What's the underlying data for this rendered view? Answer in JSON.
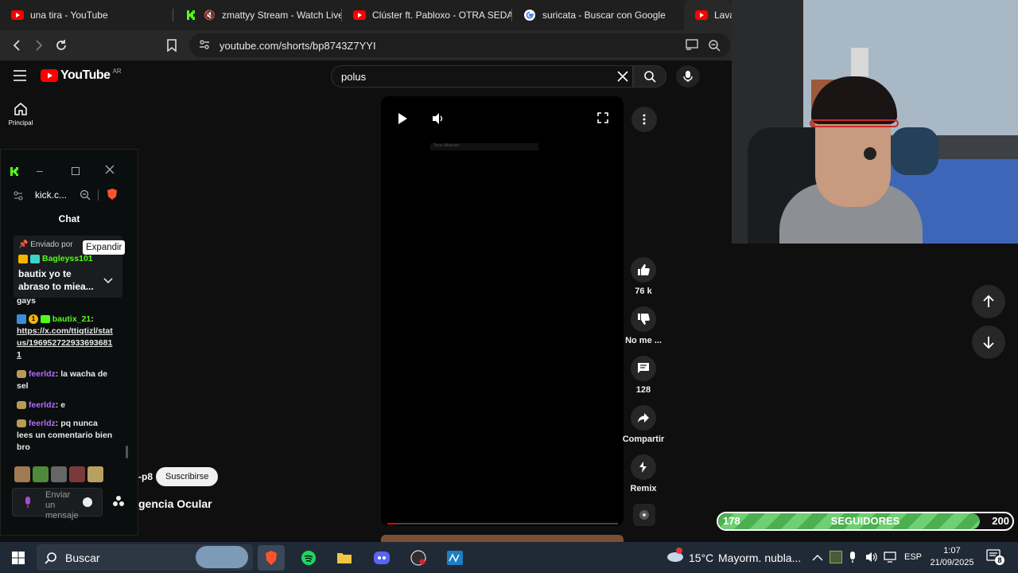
{
  "tabs": [
    {
      "title": "una tira - YouTube",
      "icon": "youtube-icon"
    },
    {
      "title": "zmattyy Stream - Watch Live o",
      "icon": "kick-icon"
    },
    {
      "title": "Clúster ft. Pabloxo - OTRA SEDA (\\",
      "icon": "youtube-icon"
    },
    {
      "title": "suricata - Buscar con Google",
      "icon": "google-icon"
    },
    {
      "title": "Lava",
      "icon": "youtube-icon"
    }
  ],
  "toolbar": {
    "url": "youtube.com/shorts/bp8743Z7YYI"
  },
  "youtube": {
    "logo_text": "YouTube",
    "region": "AR",
    "home_label": "Principal",
    "search_value": "polus",
    "actions": {
      "like_count": "76 k",
      "dislike_label": "No me ...",
      "comments_count": "128",
      "share_label": "Compartir",
      "remix_label": "Remix"
    },
    "channel_suffix": "-p8",
    "subscribe_label": "Suscribirse",
    "video_title_partial": "gencia Ocular",
    "video_caption": "Toca «Buscar»"
  },
  "kick": {
    "url": "kick.c...",
    "chat_title": "Chat",
    "pinned_label": "Enviado por",
    "expand_tooltip": "Expandir",
    "pinned_user": "Bagleyss101",
    "pinned_message": "bautix yo te abraso to miea...",
    "messages": [
      {
        "user": "",
        "text": "gays"
      },
      {
        "user": "bautix_21",
        "text": "https://x.com/ttiqtizl/status/1969527229336936811",
        "badge_number": "1"
      },
      {
        "user": "feerldz",
        "text": "la wacha de sel"
      },
      {
        "user": "feerldz",
        "text": "e"
      },
      {
        "user": "feerldz",
        "text": "pq nunca lees un comentario bien bro"
      }
    ],
    "input_placeholder": "Enviar un mensaje"
  },
  "followers": {
    "current": "178",
    "label": "SEGUIDORES",
    "goal": "200",
    "progress": 0.89
  },
  "taskbar": {
    "search_label": "Buscar",
    "weather_temp": "15°C",
    "weather_desc": "Mayorm. nubla...",
    "lang": "ESP",
    "time": "1:07",
    "date": "21/09/2025",
    "notif_count": "8"
  },
  "colors": {
    "youtube_red": "#ff0000",
    "kick_green": "#53fc18",
    "progress_green": "#5cbf60"
  }
}
